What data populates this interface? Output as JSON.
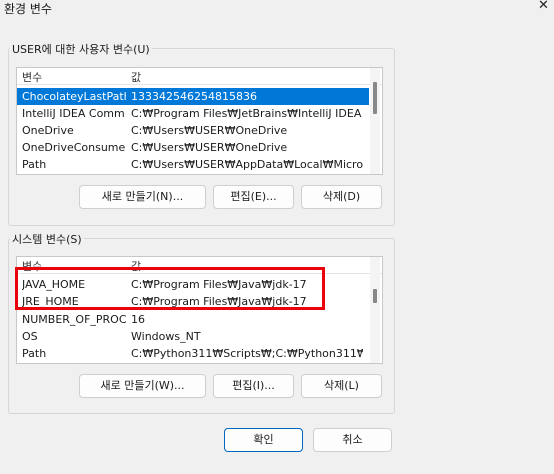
{
  "window": {
    "title": "환경 변수",
    "close_symbol": "✕"
  },
  "user_group": {
    "label": "USER에 대한 사용자 변수(U)",
    "columns": [
      "변수",
      "값"
    ],
    "rows": [
      {
        "name": "ChocolateyLastPath...",
        "value": "133342546254815836",
        "selected": true
      },
      {
        "name": "IntelliJ IDEA Comm...",
        "value": "C:₩Program Files₩JetBrains₩IntelliJ IDEA Co..."
      },
      {
        "name": "OneDrive",
        "value": "C:₩Users₩USER₩OneDrive"
      },
      {
        "name": "OneDriveConsumer",
        "value": "C:₩Users₩USER₩OneDrive"
      },
      {
        "name": "Path",
        "value": "C:₩Users₩USER₩AppData₩Local₩Microsoft..."
      }
    ],
    "buttons": {
      "new": "새로 만들기(N)...",
      "edit": "편집(E)...",
      "delete": "삭제(D)"
    }
  },
  "system_group": {
    "label": "시스템 변수(S)",
    "columns": [
      "변수",
      "값"
    ],
    "rows": [
      {
        "name": "JAVA_HOME",
        "value": "C:₩Program Files₩Java₩jdk-17"
      },
      {
        "name": "JRE_HOME",
        "value": "C:₩Program Files₩Java₩jdk-17"
      },
      {
        "name": "NUMBER_OF_PROC...",
        "value": "16"
      },
      {
        "name": "OS",
        "value": "Windows_NT"
      },
      {
        "name": "Path",
        "value": "C:₩Python311₩Scripts₩;C:₩Python311₩;C:₩P..."
      }
    ],
    "buttons": {
      "new": "새로 만들기(W)...",
      "edit": "편집(I)...",
      "delete": "삭제(L)"
    }
  },
  "footer": {
    "ok": "확인",
    "cancel": "취소"
  },
  "highlight_color": "#e8000a",
  "selection_color": "#0078d7"
}
